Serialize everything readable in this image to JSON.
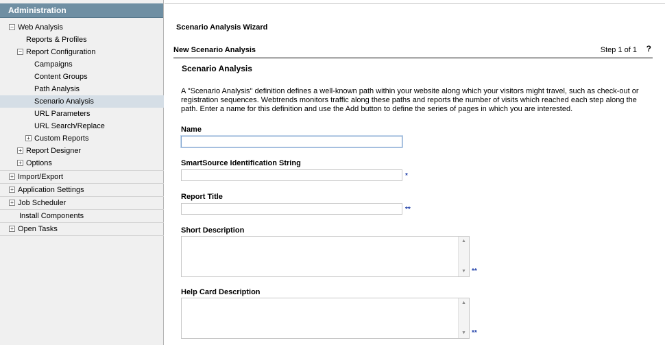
{
  "sidebar": {
    "header": "Administration",
    "items": [
      {
        "label": "Web Analysis",
        "toggle": "−"
      },
      {
        "label": "Reports & Profiles"
      },
      {
        "label": "Report Configuration",
        "toggle": "−"
      },
      {
        "label": "Campaigns"
      },
      {
        "label": "Content Groups"
      },
      {
        "label": "Path Analysis"
      },
      {
        "label": "Scenario Analysis",
        "selected": true
      },
      {
        "label": "URL Parameters"
      },
      {
        "label": "URL Search/Replace"
      },
      {
        "label": "Custom Reports",
        "toggle": "+"
      },
      {
        "label": "Report Designer",
        "toggle": "+"
      },
      {
        "label": "Options",
        "toggle": "+"
      },
      {
        "label": "Import/Export",
        "toggle": "+"
      },
      {
        "label": "Application Settings",
        "toggle": "+"
      },
      {
        "label": "Job Scheduler",
        "toggle": "+"
      },
      {
        "label": "Install Components"
      },
      {
        "label": "Open Tasks",
        "toggle": "+"
      }
    ]
  },
  "main": {
    "wizard_title": "Scenario Analysis Wizard",
    "step_title": "New Scenario Analysis",
    "step_counter": "Step 1 of 1",
    "help": "?",
    "section_title": "Scenario Analysis",
    "intro": "A \"Scenario Analysis\" definition defines a well-known path within your website along which your visitors might travel, such as check-out or registration sequences. Webtrends monitors traffic along these paths and reports the number of visits which reached each step along the path. Enter a name for this definition and use the Add button to define the series of pages in which you are interested.",
    "fields": {
      "name": {
        "label": "Name",
        "value": "",
        "required_mark": ""
      },
      "smartsource": {
        "label": "SmartSource Identification String",
        "value": "",
        "required_mark": "*"
      },
      "report_title": {
        "label": "Report Title",
        "value": "",
        "required_mark": "**"
      },
      "short_description": {
        "label": "Short Description",
        "value": "",
        "required_mark": "**"
      },
      "help_card_description": {
        "label": "Help Card Description",
        "value": "",
        "required_mark": "**"
      }
    },
    "scroll_up": "▲",
    "scroll_down": "▼"
  }
}
